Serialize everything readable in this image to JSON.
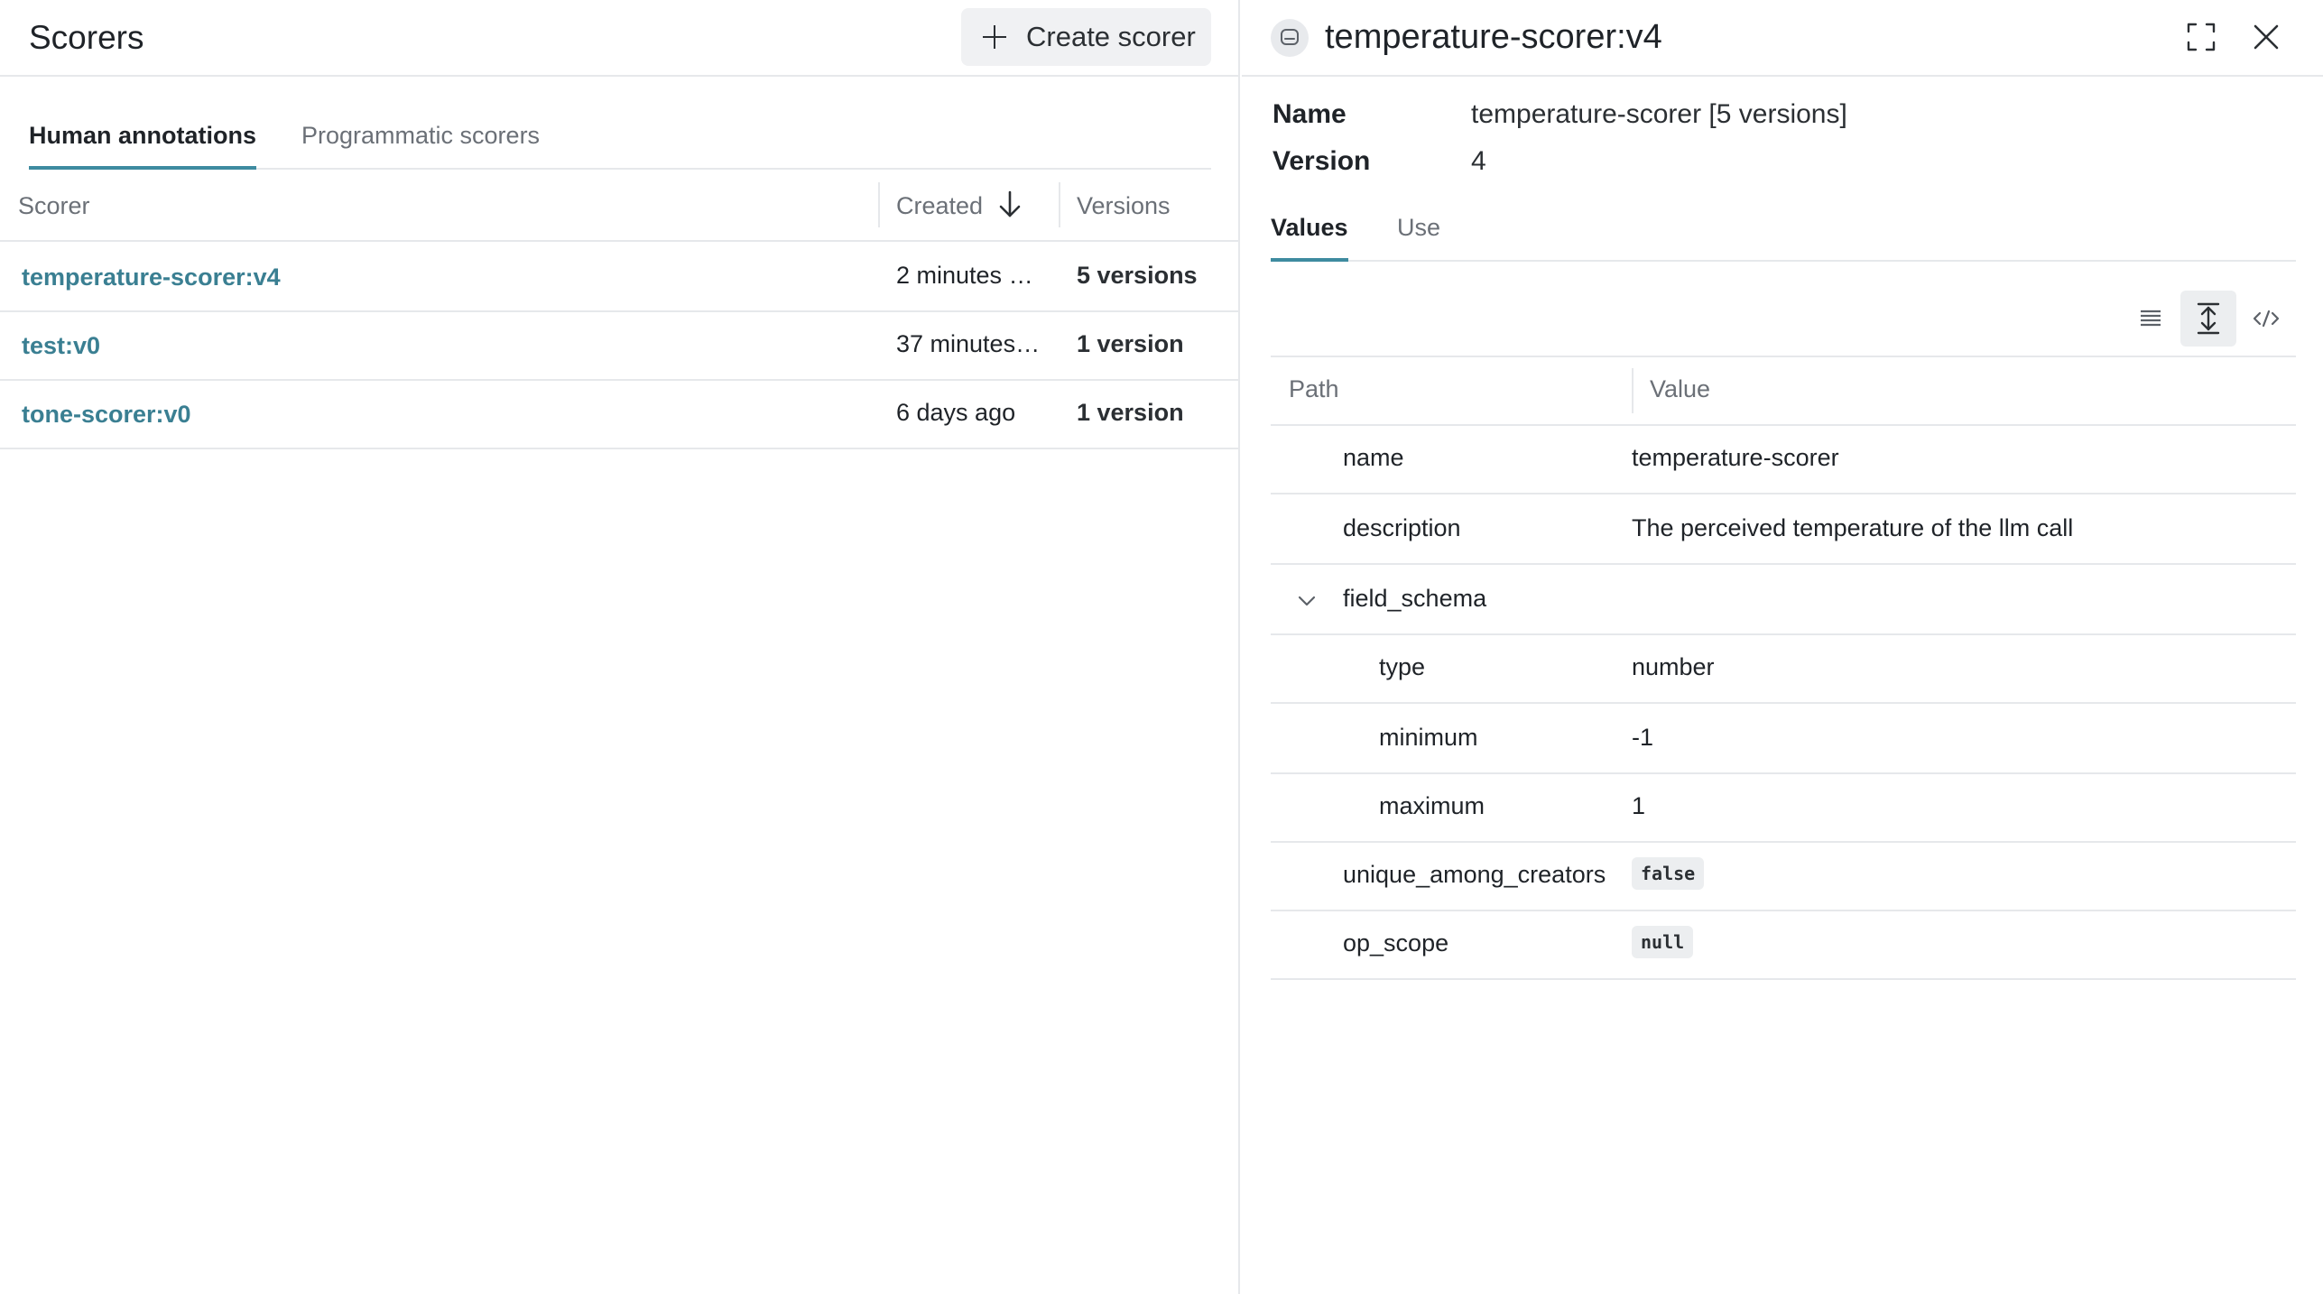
{
  "left": {
    "title": "Scorers",
    "create_button": "Create scorer",
    "tabs": [
      {
        "label": "Human annotations",
        "active": true
      },
      {
        "label": "Programmatic scorers",
        "active": false
      }
    ],
    "columns": {
      "scorer": "Scorer",
      "created": "Created",
      "versions": "Versions"
    },
    "rows": [
      {
        "name": "temperature-scorer:v4",
        "created": "2 minutes ago",
        "versions": "5 versions"
      },
      {
        "name": "test:v0",
        "created": "37 minutes ago",
        "versions": "1 version"
      },
      {
        "name": "tone-scorer:v0",
        "created": "6 days ago",
        "versions": "1 version"
      }
    ]
  },
  "right": {
    "title": "temperature-scorer:v4",
    "name_label": "Name",
    "name_value": "temperature-scorer [5 versions]",
    "version_label": "Version",
    "version_value": "4",
    "tabs": [
      {
        "label": "Values",
        "active": true
      },
      {
        "label": "Use",
        "active": false
      }
    ],
    "table_headers": {
      "path": "Path",
      "value": "Value"
    },
    "properties": [
      {
        "path": "name",
        "value": "temperature-scorer",
        "indent": 1,
        "pill": false
      },
      {
        "path": "description",
        "value": "The perceived temperature of the llm call",
        "indent": 1,
        "pill": false
      },
      {
        "path": "field_schema",
        "value": "",
        "indent": 1,
        "expandable": true,
        "pill": false
      },
      {
        "path": "type",
        "value": "number",
        "indent": 2,
        "pill": false
      },
      {
        "path": "minimum",
        "value": "-1",
        "indent": 2,
        "pill": false
      },
      {
        "path": "maximum",
        "value": "1",
        "indent": 2,
        "pill": false
      },
      {
        "path": "unique_among_creators",
        "value": "false",
        "indent": 1,
        "pill": true
      },
      {
        "path": "op_scope",
        "value": "null",
        "indent": 1,
        "pill": true
      }
    ]
  },
  "colors": {
    "accent": "#3e8ba0",
    "link": "#3a7f92",
    "border": "#e6e8eb"
  }
}
